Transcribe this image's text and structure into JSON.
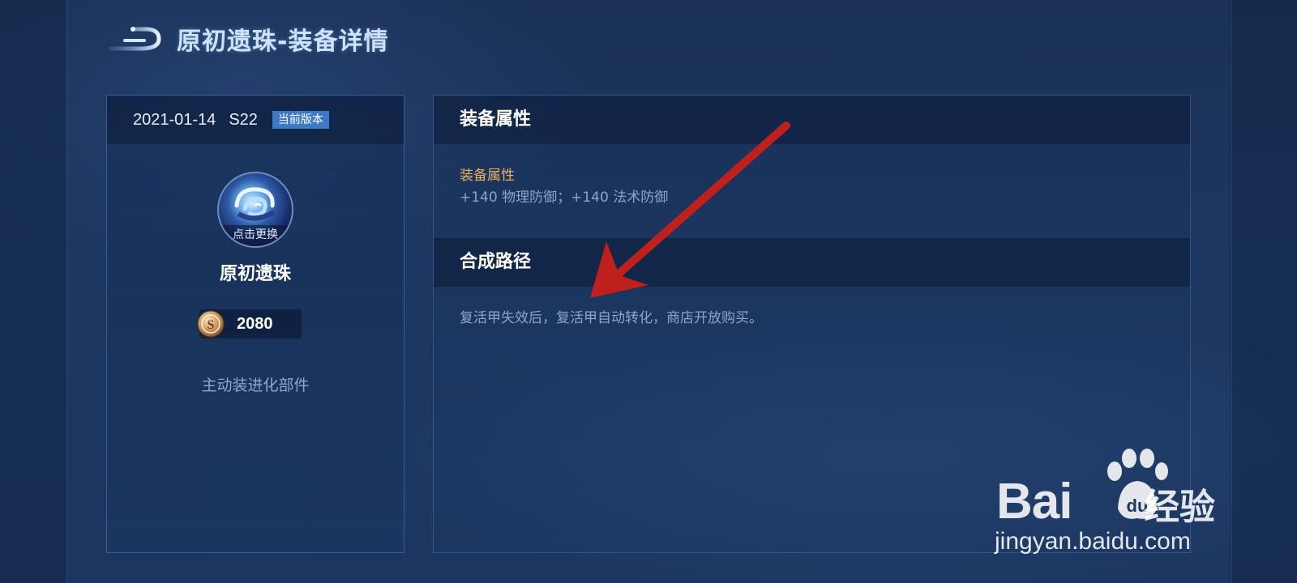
{
  "page": {
    "title": "原初遗珠-装备详情"
  },
  "item": {
    "date": "2021-01-14",
    "season": "S22",
    "version_badge": "当前版本",
    "avatar_action": "点击更换",
    "name": "原初遗珠",
    "price": "2080",
    "category": "主动装进化部件"
  },
  "attributes": {
    "heading": "装备属性",
    "label": "装备属性",
    "value": "+140 物理防御；+140 法术防御"
  },
  "synthesis": {
    "heading": "合成路径",
    "text": "复活甲失效后，复活甲自动转化，商店开放购买。"
  },
  "watermark": {
    "brand_left": "Bai",
    "brand_right": "经验",
    "url": "jingyan.baidu.com"
  },
  "colors": {
    "background": "#1a2f55",
    "accent_badge": "#3d79c4",
    "attr_label": "#e8b15c",
    "annotation_arrow": "#c0201c"
  },
  "icons": {
    "back": "back-arrow-icon",
    "coin": "gold-coin-icon",
    "avatar": "item-orb-icon"
  }
}
